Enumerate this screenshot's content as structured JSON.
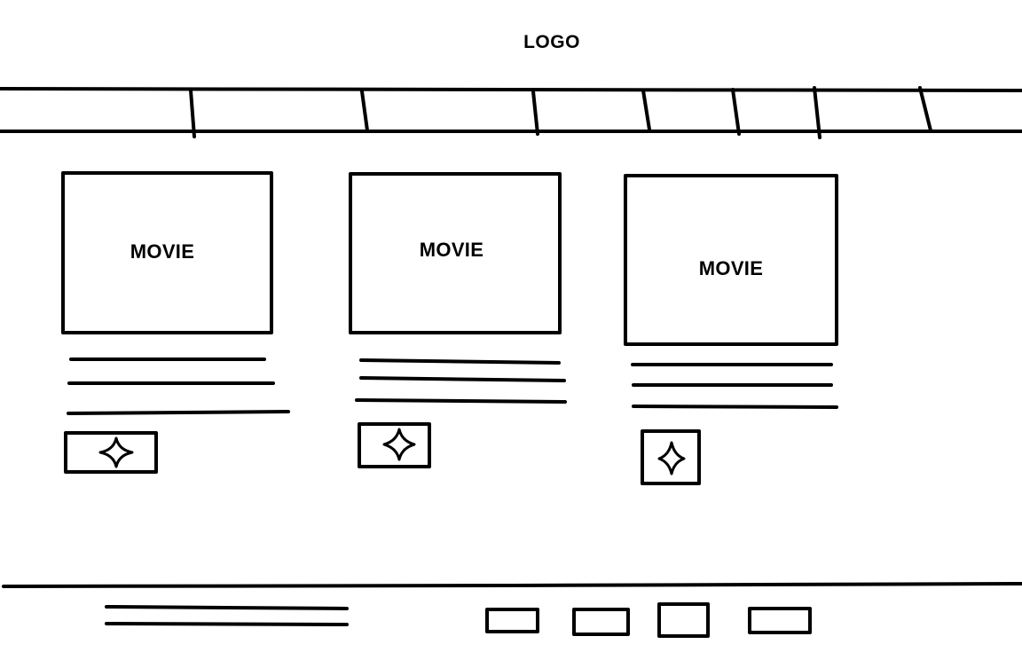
{
  "header": {
    "logo_text": "LOGO",
    "nav_items": [
      "",
      "",
      "",
      "",
      "",
      "",
      "",
      ""
    ]
  },
  "movies": [
    {
      "label": "MOVIE",
      "text_lines": 3,
      "icon": "star-icon"
    },
    {
      "label": "MOVIE",
      "text_lines": 3,
      "icon": "star-icon"
    },
    {
      "label": "MOVIE",
      "text_lines": 3,
      "icon": "star-icon"
    }
  ],
  "footer": {
    "text_lines": 2,
    "buttons": [
      "",
      "",
      "",
      ""
    ]
  },
  "colors": {
    "stroke": "#000000",
    "background": "#ffffff"
  }
}
